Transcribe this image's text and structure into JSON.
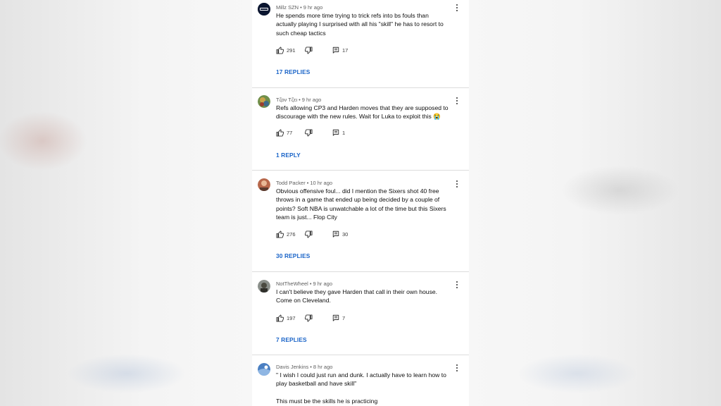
{
  "comments": [
    {
      "author": "Millz SZN",
      "time": "9 hr ago",
      "lines": [
        "He spends more time trying to trick refs into bs fouls than",
        "actually playing I surprised with all his \"skill\" he has to resort to",
        "such cheap tactics"
      ],
      "likes": "291",
      "reply_count": "17",
      "replies_label": "17 REPLIES"
    },
    {
      "author": "Τζον Τζει",
      "time": "9 hr ago",
      "lines": [
        "Refs allowing CP3 and Harden moves that they are supposed to",
        "discourage with the new rules. Wait for Luka to exploit this 😭"
      ],
      "likes": "77",
      "reply_count": "1",
      "replies_label": "1 REPLY"
    },
    {
      "author": "Todd Packer",
      "time": "10 hr ago",
      "lines": [
        "Obvious offensive foul... did I mention the Sixers shot 40 free",
        "throws in a game that ended up being decided by a couple of",
        "points? Soft NBA is unwatchable a lot of the time but this Sixers",
        "team is just... Flop City"
      ],
      "likes": "276",
      "reply_count": "30",
      "replies_label": "30 REPLIES"
    },
    {
      "author": "NotTheWheel",
      "time": "9 hr ago",
      "lines": [
        "I can't believe they gave Harden that call in their own house.",
        "Come on Cleveland."
      ],
      "likes": "197",
      "reply_count": "7",
      "replies_label": "7 REPLIES"
    },
    {
      "author": "Davis Jenkins",
      "time": "8 hr ago",
      "lines": [
        "\" I wish I could just run and dunk. I actually have to learn how to",
        "play basketball and have skill\"",
        "",
        "This must be the skills he is practicing"
      ]
    }
  ],
  "meta_separator": "•",
  "icons": {
    "like": "thumbs-up-icon",
    "dislike": "thumbs-down-icon",
    "reply": "comment-icon",
    "menu": "more-vert-icon"
  },
  "colors": {
    "link": "#1a64c8",
    "text": "#0f0f0f",
    "meta": "#606060",
    "divider": "#dcdcdc"
  }
}
